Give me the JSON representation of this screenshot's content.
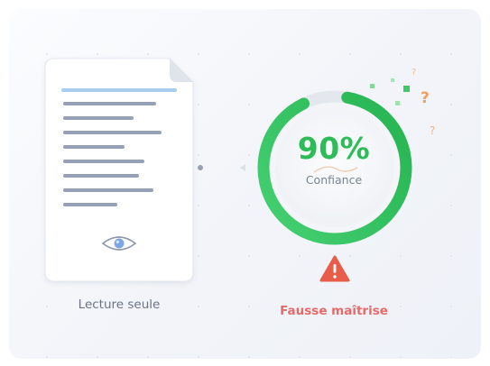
{
  "document": {
    "caption": "Lecture seule",
    "icon": "eye-icon"
  },
  "gauge": {
    "value_text": "90%",
    "value": 0.9,
    "label": "Confiance",
    "icons": [
      "question-mark-icon"
    ]
  },
  "status": {
    "text": "Fausse maîtrise",
    "icon": "warning-icon"
  },
  "colors": {
    "gauge_green": "#2ebc59",
    "warning_red": "#e85c4a",
    "status_text": "#e56a6a",
    "question_orange": "#f4a259",
    "doc_highlight": "#a9cdef",
    "doc_line": "#95a1b6"
  }
}
